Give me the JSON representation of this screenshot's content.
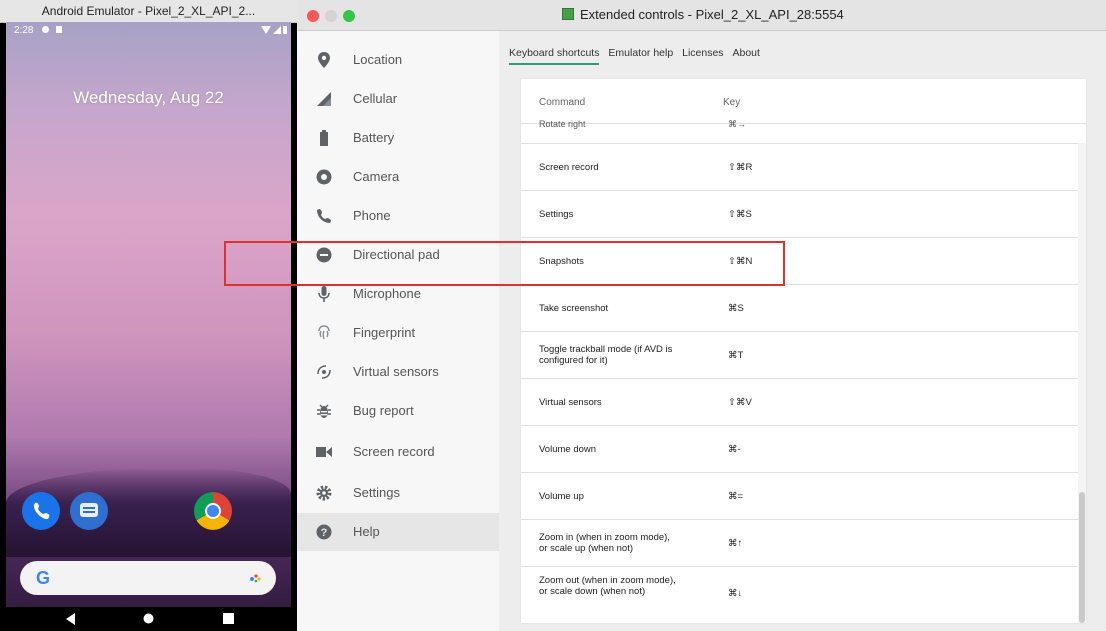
{
  "emulator": {
    "title": "Android Emulator - Pixel_2_XL_API_2...",
    "status_time": "2:28",
    "date": "Wednesday, Aug 22",
    "search_letter": "G",
    "dock_icons": [
      "phone-app-icon",
      "messages-app-icon",
      "chrome-app-icon"
    ],
    "nav_icons": [
      "back-icon",
      "home-icon",
      "recents-icon"
    ]
  },
  "extended": {
    "title": "Extended controls - Pixel_2_XL_API_28:5554",
    "sidebar": [
      {
        "label": "Location",
        "icon": "location-pin-icon"
      },
      {
        "label": "Cellular",
        "icon": "cellular-signal-icon"
      },
      {
        "label": "Battery",
        "icon": "battery-icon"
      },
      {
        "label": "Camera",
        "icon": "camera-icon"
      },
      {
        "label": "Phone",
        "icon": "phone-icon"
      },
      {
        "label": "Directional pad",
        "icon": "dpad-icon"
      },
      {
        "label": "Microphone",
        "icon": "microphone-icon"
      },
      {
        "label": "Fingerprint",
        "icon": "fingerprint-icon"
      },
      {
        "label": "Virtual sensors",
        "icon": "virtual-sensors-icon"
      },
      {
        "label": "Bug report",
        "icon": "bug-icon"
      },
      {
        "label": "Screen record",
        "icon": "video-camera-icon"
      },
      {
        "label": "Settings",
        "icon": "gear-icon"
      },
      {
        "label": "Help",
        "icon": "help-icon",
        "active": true
      }
    ],
    "tabs": [
      {
        "label": "Keyboard shortcuts",
        "active": true
      },
      {
        "label": "Emulator help"
      },
      {
        "label": "Licenses"
      },
      {
        "label": "About"
      }
    ],
    "table": {
      "headers": {
        "command": "Command",
        "key": "Key"
      },
      "partial_row": {
        "command": "Rotate right",
        "key": "⌘→"
      },
      "rows": [
        {
          "command": "Screen record",
          "key": "⇧⌘R"
        },
        {
          "command": "Settings",
          "key": "⇧⌘S"
        },
        {
          "command": "Snapshots",
          "key": "⇧⌘N",
          "highlighted": true
        },
        {
          "command": "Take screenshot",
          "key": "⌘S"
        },
        {
          "command": "Toggle trackball mode (if AVD is configured for it)",
          "key": "⌘T"
        },
        {
          "command": "Virtual sensors",
          "key": "⇧⌘V"
        },
        {
          "command": "Volume down",
          "key": "⌘-"
        },
        {
          "command": "Volume up",
          "key": "⌘="
        },
        {
          "command": "Zoom in (when in zoom mode), or scale up (when not)",
          "key": "⌘↑"
        },
        {
          "command": "Zoom out (when in zoom mode), or scale down (when not)",
          "key": "⌘↓"
        }
      ]
    },
    "colors": {
      "highlight": "#e03131",
      "tab_underline": "#2e9a7a",
      "title_icon": "#46a049"
    }
  }
}
